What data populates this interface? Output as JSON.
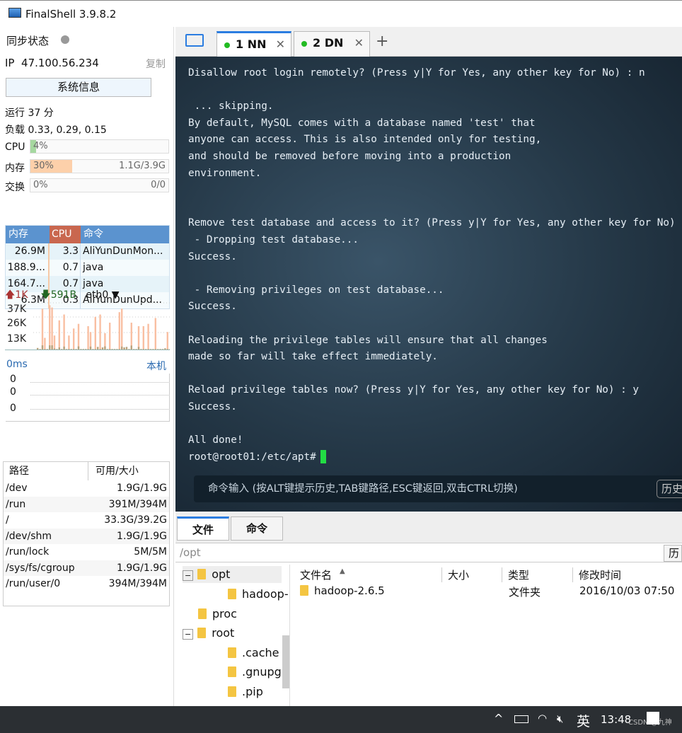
{
  "app": {
    "title": "FinalShell 3.9.8.2"
  },
  "sidebar": {
    "sync_label": "同步状态",
    "ip_label": "IP",
    "ip": "47.100.56.234",
    "copy": "复制",
    "sysinfo_button": "系统信息",
    "uptime": "运行 37 分",
    "load": "负载 0.33, 0.29, 0.15",
    "cpu": {
      "label": "CPU",
      "text": "4%",
      "percent": 4,
      "color": "#a6d8a0"
    },
    "mem": {
      "label": "内存",
      "text": "30%",
      "detail": "1.1G/3.9G",
      "percent": 30,
      "color": "#fdd0aa"
    },
    "swap": {
      "label": "交换",
      "text": "0%",
      "detail": "0/0",
      "percent": 0
    },
    "proc": {
      "headers": [
        "内存",
        "CPU",
        "命令"
      ],
      "rows": [
        {
          "mem": "26.9M",
          "cpu": "3.3",
          "cmd": "AliYunDunMon..."
        },
        {
          "mem": "188.9...",
          "cpu": "0.7",
          "cmd": "java"
        },
        {
          "mem": "164.7...",
          "cpu": "0.7",
          "cmd": "java"
        },
        {
          "mem": "6.3M",
          "cpu": "0.3",
          "cmd": "AliYunDunUpd..."
        }
      ]
    },
    "net": {
      "up": "1K",
      "down": "591B",
      "iface": "eth0",
      "ticks": [
        "37K",
        "26K",
        "13K"
      ],
      "upload": [
        0,
        0,
        35,
        10,
        0,
        38,
        36,
        12,
        0,
        25,
        0,
        30,
        0,
        12,
        0,
        18,
        0,
        22,
        0,
        0,
        0,
        20,
        15,
        0,
        28,
        0,
        30,
        0,
        14,
        0,
        23,
        0,
        0,
        0,
        32,
        35,
        0,
        0,
        0,
        23,
        0,
        0,
        20,
        0,
        20,
        0,
        22,
        0,
        0,
        27,
        0,
        0,
        0,
        0,
        15,
        0
      ],
      "download": [
        15,
        5,
        40,
        5,
        5,
        40,
        40,
        10,
        5,
        20,
        5,
        28,
        5,
        5,
        5,
        5,
        5,
        30,
        5,
        5,
        5,
        5,
        28,
        5,
        5,
        25,
        5,
        20,
        30,
        5,
        5,
        5,
        5,
        5,
        5,
        28,
        20,
        25,
        5,
        38,
        5,
        5,
        25,
        5,
        5,
        5,
        5,
        5,
        5,
        5,
        5,
        5,
        5,
        12,
        5,
        5
      ]
    },
    "ping": {
      "latency": "0ms",
      "host": "本机",
      "values": [
        "0",
        "0",
        "0"
      ]
    },
    "disk": {
      "headers": [
        "路径",
        "可用/大小"
      ],
      "rows": [
        {
          "path": "/dev",
          "size": "1.9G/1.9G"
        },
        {
          "path": "/run",
          "size": "391M/394M"
        },
        {
          "path": "/",
          "size": "33.3G/39.2G"
        },
        {
          "path": "/dev/shm",
          "size": "1.9G/1.9G"
        },
        {
          "path": "/run/lock",
          "size": "5M/5M"
        },
        {
          "path": "/sys/fs/cgroup",
          "size": "1.9G/1.9G"
        },
        {
          "path": "/run/user/0",
          "size": "394M/394M"
        }
      ]
    }
  },
  "tabs": [
    {
      "label": "1 NN",
      "active": true
    },
    {
      "label": "2 DN",
      "active": false
    }
  ],
  "terminal": {
    "lines": [
      "Disallow root login remotely? (Press y|Y for Yes, any other key for No) : n",
      "",
      " ... skipping.",
      "By default, MySQL comes with a database named 'test' that",
      "anyone can access. This is also intended only for testing,",
      "and should be removed before moving into a production",
      "environment.",
      "",
      "",
      "Remove test database and access to it? (Press y|Y for Yes, any other key for No) : y",
      " - Dropping test database...",
      "Success.",
      "",
      " - Removing privileges on test database...",
      "Success.",
      "",
      "Reloading the privilege tables will ensure that all changes",
      "made so far will take effect immediately.",
      "",
      "Reload privilege tables now? (Press y|Y for Yes, any other key for No) : y",
      "Success.",
      "",
      "All done!"
    ],
    "prompt": "root@root01:/etc/apt#",
    "cmd_hint": "命令输入 (按ALT键提示历史,TAB键路径,ESC键返回,双击CTRL切换)",
    "history": "历史"
  },
  "files": {
    "tabs": [
      "文件",
      "命令"
    ],
    "path": "/opt",
    "history": "历",
    "tree": [
      {
        "name": "opt",
        "level": 0,
        "selected": true,
        "expander": "−"
      },
      {
        "name": "hadoop-",
        "level": 1
      },
      {
        "name": "proc",
        "level": 0
      },
      {
        "name": "root",
        "level": 0,
        "expander": "−"
      },
      {
        "name": ".cache",
        "level": 1
      },
      {
        "name": ".gnupg",
        "level": 1
      },
      {
        "name": ".pip",
        "level": 1
      }
    ],
    "columns": [
      "文件名",
      "大小",
      "类型",
      "修改时间"
    ],
    "rows": [
      {
        "name": "hadoop-2.6.5",
        "size": "",
        "type": "文件夹",
        "mtime": "2016/10/03 07:50"
      }
    ]
  },
  "taskbar": {
    "ime": "英",
    "time": "13:48",
    "watermark": "CSDN @九神"
  }
}
